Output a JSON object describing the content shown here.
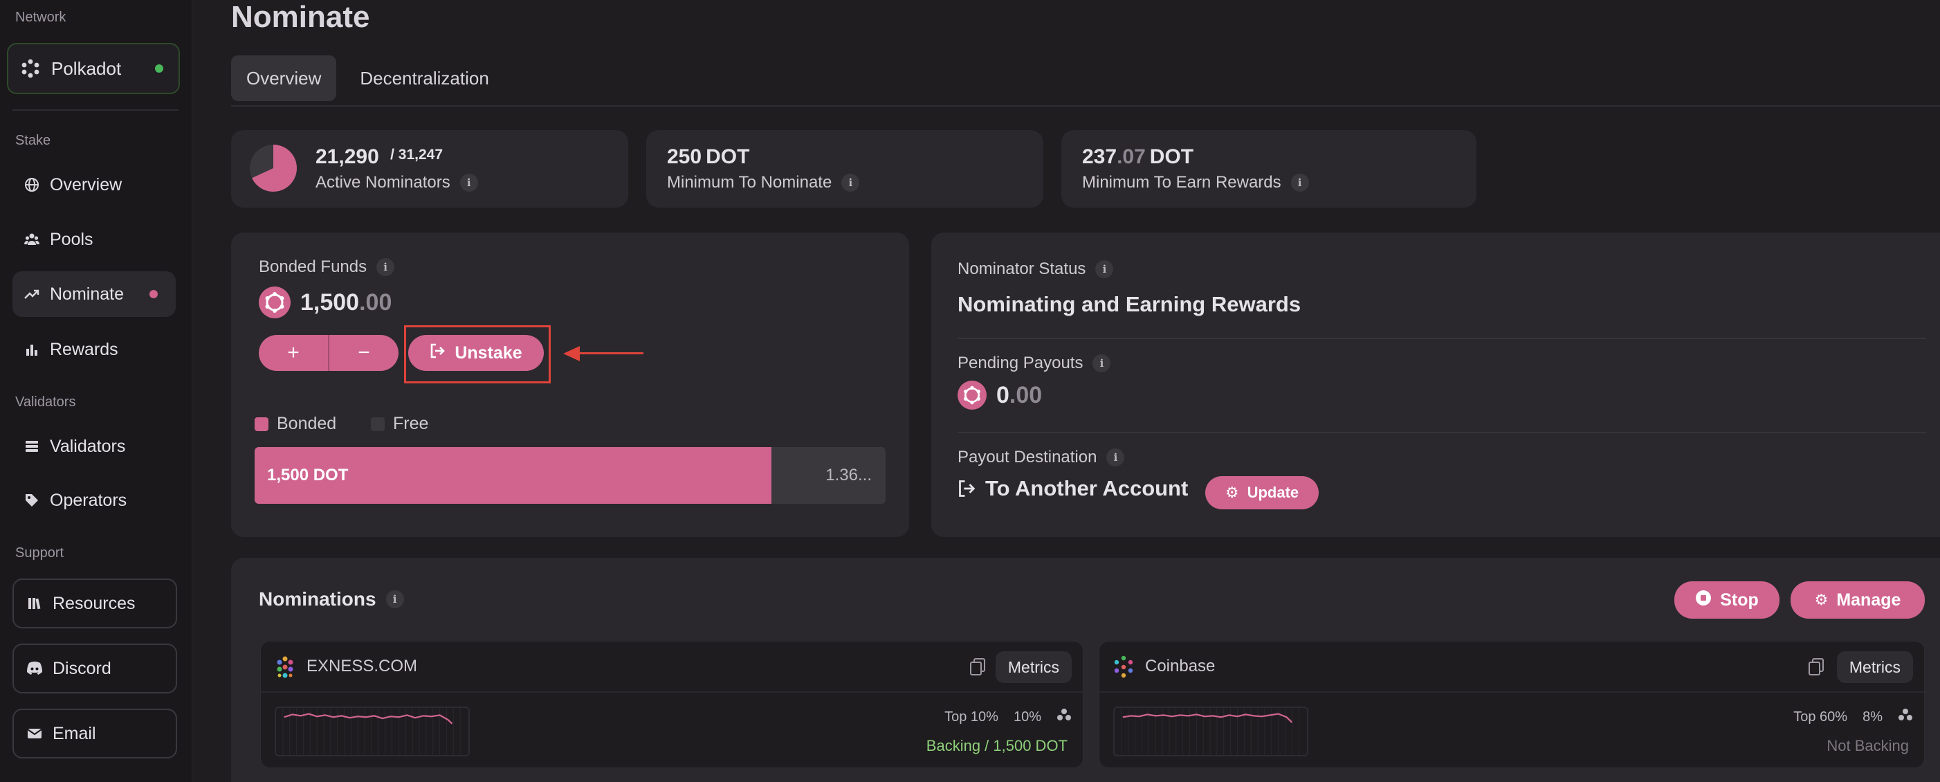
{
  "sidebar": {
    "network_section": "Network",
    "network_name": "Polkadot",
    "stake_section": "Stake",
    "stake_items": [
      {
        "label": "Overview"
      },
      {
        "label": "Pools"
      },
      {
        "label": "Nominate"
      },
      {
        "label": "Rewards"
      }
    ],
    "validators_section": "Validators",
    "validators_items": [
      {
        "label": "Validators"
      },
      {
        "label": "Operators"
      }
    ],
    "support_section": "Support",
    "support_items": [
      {
        "label": "Resources"
      },
      {
        "label": "Discord"
      },
      {
        "label": "Email"
      }
    ]
  },
  "page": {
    "title": "Nominate",
    "tabs": [
      {
        "label": "Overview",
        "active": true
      },
      {
        "label": "Decentralization",
        "active": false
      }
    ]
  },
  "stats": {
    "active_nominators": {
      "value": "21,290",
      "total": "/ 31,247",
      "label": "Active Nominators",
      "fraction": 0.681
    },
    "min_nominate": {
      "value": "250",
      "unit": "DOT",
      "label": "Minimum To Nominate"
    },
    "min_rewards": {
      "value_int": "237",
      "value_dec": ".07",
      "unit": "DOT",
      "label": "Minimum To Earn Rewards"
    }
  },
  "bonded": {
    "label": "Bonded Funds",
    "amount_int": "1,500",
    "amount_dec": ".00",
    "plus": "+",
    "minus": "−",
    "unstake_label": "Unstake",
    "legend_bonded": "Bonded",
    "legend_free": "Free",
    "bar_bonded_label": "1,500 DOT",
    "bar_free_label": "1.36...",
    "bonded_fraction": 0.819
  },
  "status": {
    "nominator_status_label": "Nominator Status",
    "nominator_status_value": "Nominating and Earning Rewards",
    "pending_payouts_label": "Pending Payouts",
    "pending_int": "0",
    "pending_dec": ".00",
    "payout_destination_label": "Payout Destination",
    "payout_destination_value": "To Another Account",
    "update_label": "Update"
  },
  "nominations": {
    "title": "Nominations",
    "stop_label": "Stop",
    "manage_label": "Manage",
    "validators": [
      {
        "name": "EXNESS.COM",
        "metrics_label": "Metrics",
        "rank": "Top 10%",
        "commission": "10%",
        "backing": "Backing / 1,500 DOT",
        "backing_color": "#8fd07a"
      },
      {
        "name": "Coinbase",
        "metrics_label": "Metrics",
        "rank": "Top 60%",
        "commission": "8%",
        "backing": "Not Backing",
        "backing_color": "#7c7781"
      }
    ]
  },
  "colors": {
    "accent": "#d0648f",
    "annotation": "#e0433a",
    "online": "#49b85a"
  }
}
